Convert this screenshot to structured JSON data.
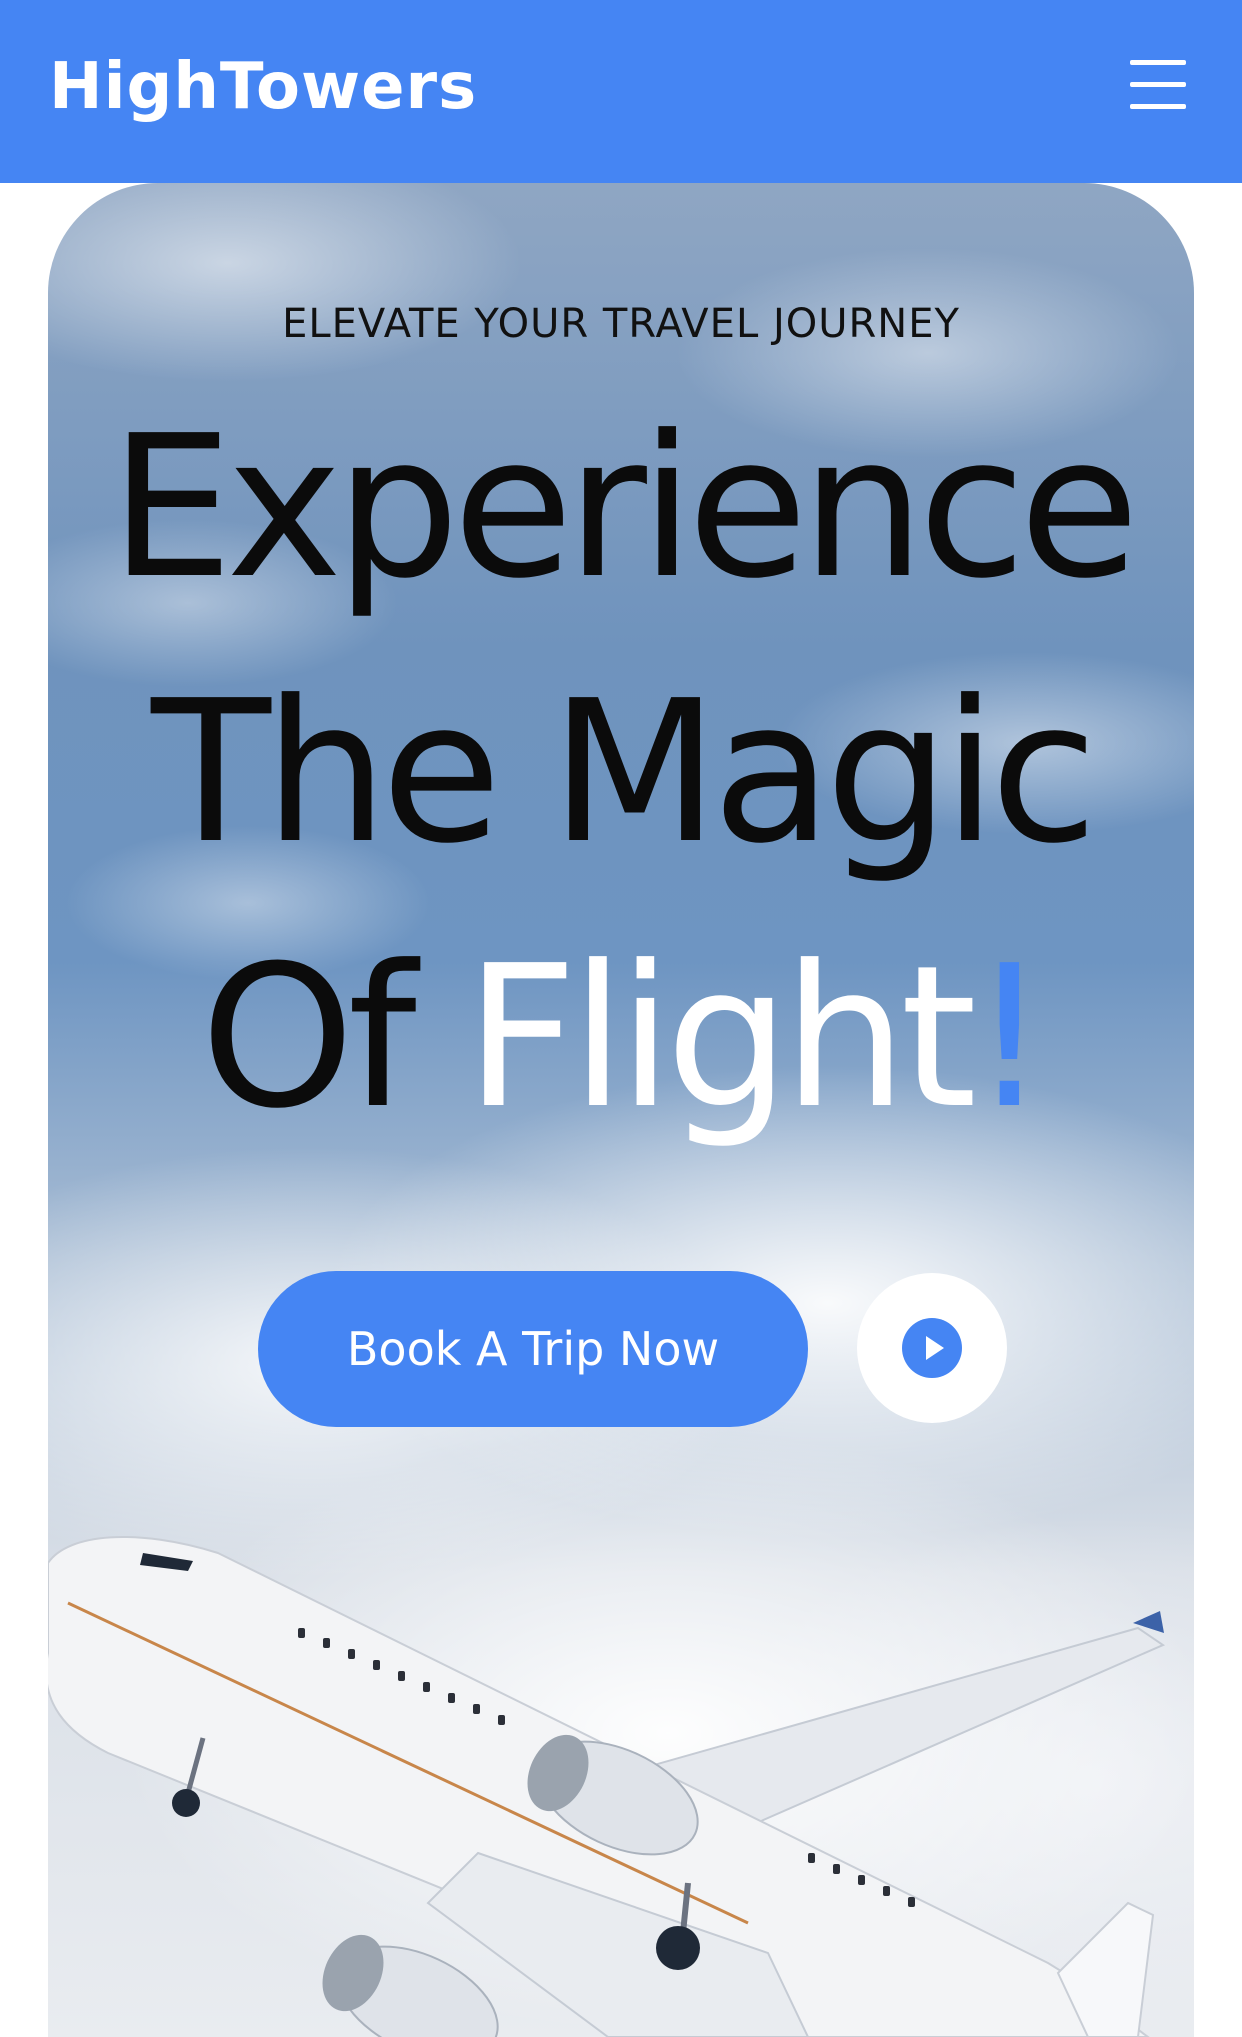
{
  "header": {
    "brand": "HighTowers",
    "menu_icon": "hamburger-menu-icon",
    "background_color": "#4585f3"
  },
  "hero": {
    "eyebrow": "ELEVATE YOUR TRAVEL JOURNEY",
    "headline": {
      "line1": "Experience",
      "line2": "The Magic",
      "line3_prefix": "Of ",
      "line3_highlight": "Flight",
      "line3_accent": "!"
    },
    "cta_label": "Book A Trip Now",
    "play_icon": "play-circle-icon",
    "background_image": "sky-with-clouds-and-airplane",
    "airplane_image": "airplane-taking-off-image",
    "accent_color": "#4585f3"
  }
}
